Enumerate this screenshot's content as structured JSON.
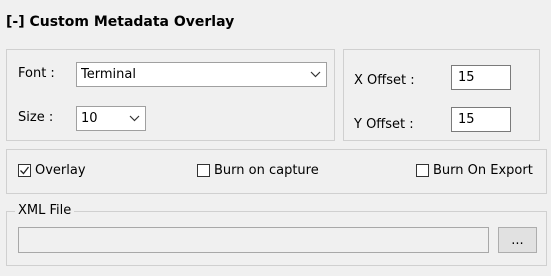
{
  "section": {
    "title": "[-] Custom Metadata Overlay"
  },
  "font_group": {
    "font_label": "Font :",
    "font_value": "Terminal",
    "size_label": "Size :",
    "size_value": "10"
  },
  "offset_group": {
    "x_label": "X Offset :",
    "x_value": "15",
    "y_label": "Y Offset :",
    "y_value": "15"
  },
  "options": {
    "overlay_label": "Overlay",
    "overlay_checked": true,
    "burn_capture_label": "Burn on capture",
    "burn_capture_checked": false,
    "burn_export_label": "Burn On Export",
    "burn_export_checked": false
  },
  "xml": {
    "legend": "XML File",
    "path_value": "",
    "browse_label": "..."
  },
  "icons": {
    "dropdown": "chevron-down-icon",
    "check": "checkmark-icon"
  }
}
